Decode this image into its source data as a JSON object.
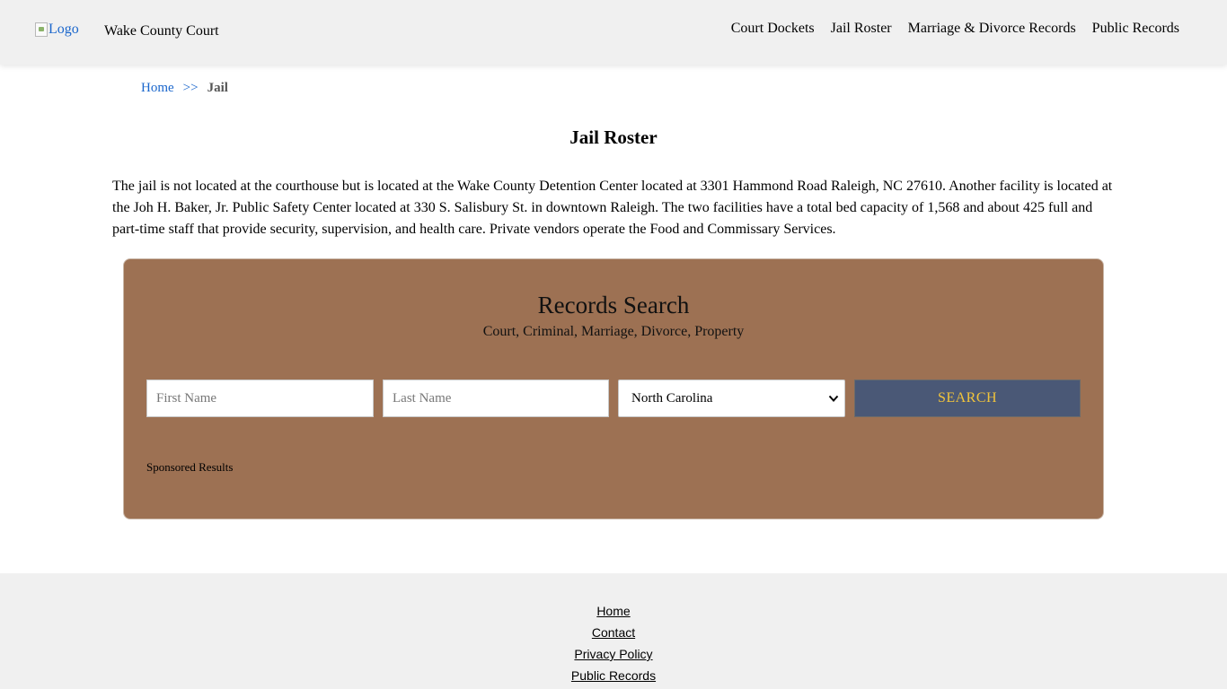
{
  "header": {
    "logo_alt": "Logo",
    "site_title": "Wake County Court",
    "nav": [
      "Court Dockets",
      "Jail Roster",
      "Marriage & Divorce Records",
      "Public Records"
    ]
  },
  "breadcrumb": {
    "home": "Home",
    "separator": ">>",
    "current": "Jail"
  },
  "main": {
    "title": "Jail Roster",
    "intro": "The jail is not located at the courthouse but is located at the Wake County Detention Center located at 3301 Hammond Road Raleigh, NC 27610. Another facility is located at the Joh H. Baker, Jr. Public Safety Center located at 330 S. Salisbury St. in downtown Raleigh. The two facilities have a total bed capacity of 1,568 and about 425 full and part-time staff that provide security, supervision, and health care. Private vendors operate the Food and Commissary Services."
  },
  "search": {
    "title": "Records Search",
    "subtitle": "Court, Criminal, Marriage, Divorce, Property",
    "first_name_placeholder": "First Name",
    "last_name_placeholder": "Last Name",
    "state_selected": "North Carolina",
    "button_label": "SEARCH",
    "sponsored": "Sponsored Results"
  },
  "footer": {
    "links": [
      "Home",
      "Contact",
      "Privacy Policy",
      "Public Records"
    ]
  },
  "colors": {
    "panel": "#9d7153",
    "button": "#4a5876",
    "button_text": "#f2c53b",
    "link": "#1a66cc"
  }
}
